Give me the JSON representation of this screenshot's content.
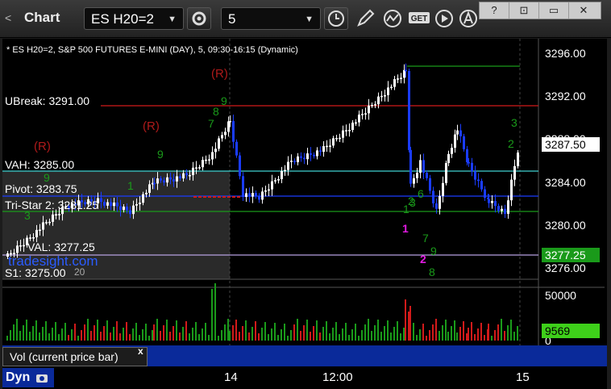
{
  "window": {
    "title": "Chart",
    "back_glyph": "<"
  },
  "toolbar": {
    "symbol": "ES H20=2",
    "interval": "5",
    "icons": [
      "settings-gear-icon",
      "clock-icon",
      "pencil-icon",
      "indicator-icon",
      "get-icon",
      "play-icon",
      "alert-icon"
    ],
    "window_buttons": [
      "?",
      "⊡",
      "▭",
      "✕"
    ]
  },
  "chart": {
    "header": "* ES H20=2, S&P 500 FUTURES E-MINI (DAY), 5, 09:30-16:15 (Dynamic)",
    "watermark": "tradesight.com",
    "levels": {
      "ubreak": "UBreak: 3291.00",
      "vah": "VAH: 3285.00",
      "pivot": "Pivot: 3283.75",
      "tristar": "Tri-Star 2: 3281.25",
      "val": "VAL: 3277.25",
      "s1": "S1: 3275.00",
      "level20": "20"
    },
    "markers": {
      "r1": "(R)",
      "r2": "(R)",
      "r3": "(R)",
      "one": "1",
      "two": "2"
    },
    "y_ticks": [
      "3296.00",
      "3292.00",
      "3288.00",
      "3284.00",
      "3280.00",
      "3276.00"
    ],
    "current_price": "3287.50",
    "val_price": "3277.25",
    "colors": {
      "up": "#ffffff",
      "down": "#1a3cff",
      "green": "#1a9a1a",
      "red": "#d11a1a",
      "cyan": "#3fd0d0",
      "magenta": "#e01ae0"
    }
  },
  "volume": {
    "label": "Vol (current price bar)",
    "close_glyph": "x",
    "y_ticks": [
      "50000",
      "0"
    ],
    "current": "9569"
  },
  "bottom": {
    "dyn": "Dyn",
    "x_ticks": [
      "14",
      "12:00",
      "15"
    ]
  }
}
